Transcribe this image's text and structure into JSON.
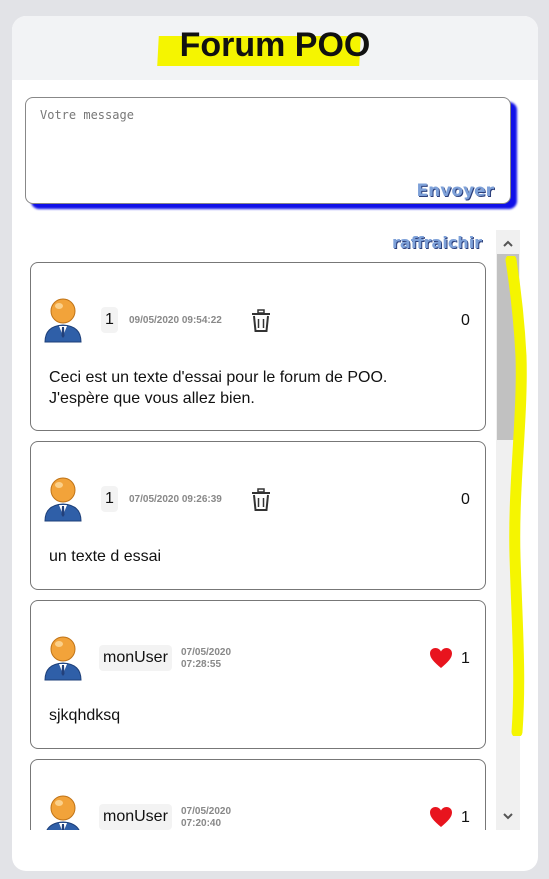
{
  "header": {
    "title": "Forum POO"
  },
  "composer": {
    "placeholder": "Votre message",
    "send_label": "Envoyer"
  },
  "refresh_label": "raffraichir",
  "posts": [
    {
      "author": "1",
      "date": "09/05/2020 09:54:22",
      "likes": "0",
      "text_line1": "Ceci est un texte d'essai pour le forum de POO.",
      "text_line2": "J'espère que vous allez bien."
    },
    {
      "author": "1",
      "date": "07/05/2020 09:26:39",
      "likes": "0",
      "text": "un texte d essai"
    },
    {
      "author": "monUser",
      "date_line1": "07/05/2020",
      "date_line2": "07:28:55",
      "likes": "1",
      "text": "sjkqhdksq"
    },
    {
      "author": "monUser",
      "date_line1": "07/05/2020",
      "date_line2": "07:20:40",
      "likes": "1"
    }
  ],
  "colors": {
    "accent_blue": "#1010e8",
    "highlight_yellow": "#f5f500",
    "heart_red": "#e8141e",
    "link_blue": "#7da0d8"
  },
  "icons": [
    "user-avatar-icon",
    "trash-icon",
    "heart-icon",
    "chevron-up-icon",
    "chevron-down-icon"
  ]
}
